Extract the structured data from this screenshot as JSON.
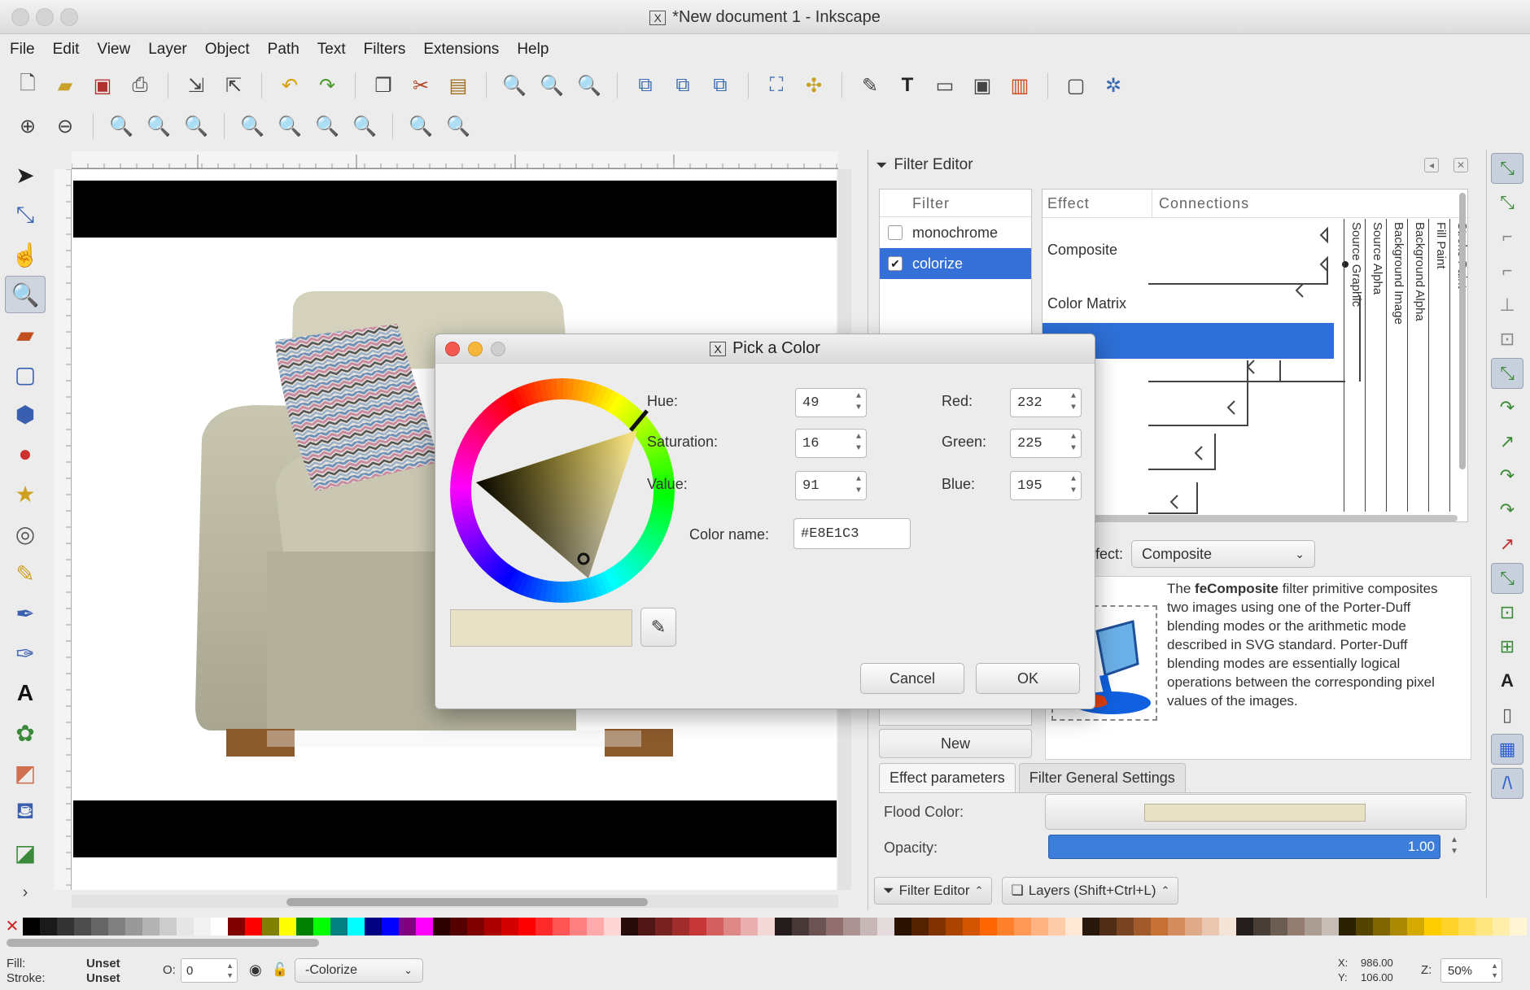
{
  "window": {
    "title": "*New document 1 - Inkscape"
  },
  "menu": [
    "File",
    "Edit",
    "View",
    "Layer",
    "Object",
    "Path",
    "Text",
    "Filters",
    "Extensions",
    "Help"
  ],
  "filter_editor": {
    "title": "Filter Editor",
    "filter_header": "Filter",
    "filters": [
      {
        "name": "monochrome",
        "checked": false,
        "selected": false
      },
      {
        "name": "colorize",
        "checked": true,
        "selected": true
      }
    ],
    "effect_header": "Effect",
    "connections_header": "Connections",
    "effects": [
      "Composite",
      "Color Matrix"
    ],
    "inputs": [
      "Source Graphic",
      "Source Alpha",
      "Background Image",
      "Background Alpha",
      "Fill Paint",
      "Stroke Paint"
    ],
    "add_effect_label": "Add Effect:",
    "add_effect_partial": "fect:",
    "add_effect_value": "Composite",
    "description_lead": "The ",
    "description_name": "feComposite",
    "description_rest": " filter primitive composites two images using one of the Porter-Duff blending modes or the arithmetic mode described in SVG standard. Porter-Duff blending modes are essentially logical operations between the corresponding pixel values of the images.",
    "new_button": "New",
    "tabs": [
      "Effect parameters",
      "Filter General Settings"
    ],
    "flood_color_label": "Flood Color:",
    "flood_color": "#E8E1C3",
    "opacity_label": "Opacity:",
    "opacity_value": "1.00"
  },
  "dock_tabs": [
    "Filter Editor",
    "Layers (Shift+Ctrl+L)"
  ],
  "dialog": {
    "title": "Pick a Color",
    "hue_label": "Hue:",
    "hue": "49",
    "saturation_label": "Saturation:",
    "saturation": "16",
    "value_label": "Value:",
    "value": "91",
    "red_label": "Red:",
    "red": "232",
    "green_label": "Green:",
    "green": "225",
    "blue_label": "Blue:",
    "blue": "195",
    "color_name_label": "Color name:",
    "color_name": "#E8E1C3",
    "cancel": "Cancel",
    "ok": "OK",
    "preview_color": "#E8E1C3"
  },
  "status": {
    "fill_label": "Fill:",
    "fill_value": "Unset",
    "stroke_label": "Stroke:",
    "stroke_value": "Unset",
    "opacity_prefix": "O:",
    "opacity": "0",
    "layer": "-Colorize",
    "x_label": "X:",
    "x": "986.00",
    "y_label": "Y:",
    "y": "106.00",
    "zoom_label": "Z:",
    "zoom": "50%"
  },
  "palette": [
    "#000000",
    "#1a1a1a",
    "#333333",
    "#4d4d4d",
    "#666666",
    "#808080",
    "#999999",
    "#b3b3b3",
    "#cccccc",
    "#e6e6e6",
    "#f2f2f2",
    "#ffffff",
    "#800000",
    "#ff0000",
    "#808000",
    "#ffff00",
    "#008000",
    "#00ff00",
    "#008080",
    "#00ffff",
    "#000080",
    "#0000ff",
    "#800080",
    "#ff00ff",
    "#2b0000",
    "#550000",
    "#800000",
    "#aa0000",
    "#d40000",
    "#ff0000",
    "#ff2a2a",
    "#ff5555",
    "#ff8080",
    "#ffaaaa",
    "#ffd5d5",
    "#280b0b",
    "#501616",
    "#782121",
    "#a02c2c",
    "#c83737",
    "#d35f5f",
    "#de8787",
    "#e9afaf",
    "#f4d7d7",
    "#241c1c",
    "#483737",
    "#6c5353",
    "#916f6f",
    "#ac9393",
    "#c8b7b7",
    "#e3dbdb",
    "#2b1100",
    "#552200",
    "#803300",
    "#aa4400",
    "#d45500",
    "#ff6600",
    "#ff7f2a",
    "#ff9955",
    "#ffb380",
    "#ffccaa",
    "#ffe6d5",
    "#28170b",
    "#502d16",
    "#784421",
    "#a05a2c",
    "#c87137",
    "#d38d5f",
    "#deaa87",
    "#e9c6af",
    "#f4e3d7",
    "#241f1c",
    "#483e37",
    "#6c5d53",
    "#917c6f",
    "#ac9d93",
    "#c8beb7",
    "#2b2200",
    "#554400",
    "#806600",
    "#aa8800",
    "#d4aa00",
    "#ffcc00",
    "#ffd42a",
    "#ffdd55",
    "#ffe680",
    "#ffeeaa",
    "#fff6d5"
  ],
  "colors": {
    "accent": "#3470d8",
    "selection": "#2d6fd6"
  }
}
